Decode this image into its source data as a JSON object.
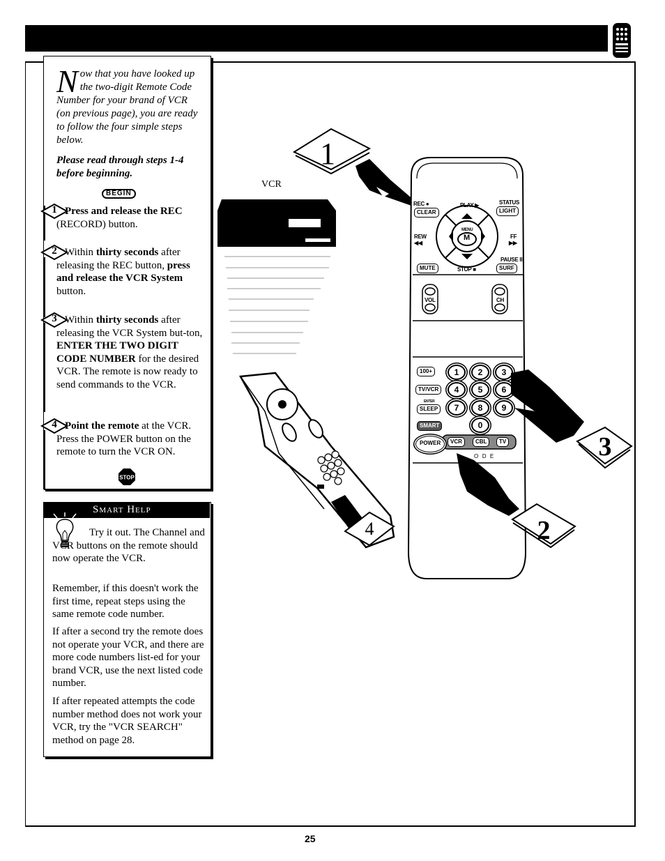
{
  "header": {
    "icon": "remote-control-icon"
  },
  "instructions": {
    "intro_dropcap": "N",
    "intro_text": "ow that you have looked up the two-digit Remote Code Number for your brand of VCR (on previous page), you are ready to follow the four simple steps below.",
    "please_read": "Please read through steps 1-4 before beginning.",
    "begin_label": "BEGIN",
    "steps": [
      {
        "number": "1",
        "parts": [
          {
            "b": true,
            "t": "Press and release the REC"
          },
          {
            "b": false,
            "t": " (RECORD) button."
          }
        ]
      },
      {
        "number": "2",
        "parts": [
          {
            "b": false,
            "t": "Within "
          },
          {
            "b": true,
            "t": "thirty seconds"
          },
          {
            "b": false,
            "t": " after releasing the REC button, "
          },
          {
            "b": true,
            "t": "press and release the VCR System"
          },
          {
            "b": false,
            "t": " button."
          }
        ]
      },
      {
        "number": "3",
        "parts": [
          {
            "b": false,
            "t": "Within "
          },
          {
            "b": true,
            "t": "thirty seconds"
          },
          {
            "b": false,
            "t": " after releasing the VCR System but-ton, "
          },
          {
            "b": true,
            "t": "ENTER THE TWO DIGIT CODE NUMBER"
          },
          {
            "b": false,
            "t": " for the desired VCR. The remote is now ready to send commands to the VCR."
          }
        ]
      },
      {
        "number": "4",
        "parts": [
          {
            "b": true,
            "t": "Point the remote"
          },
          {
            "b": false,
            "t": " at the VCR. Press the POWER button on the remote to turn the VCR ON."
          }
        ]
      }
    ],
    "stop_label": "STOP"
  },
  "smart_help": {
    "title": "Smart Help",
    "paragraphs": [
      "Try it out. The Channel and VCR buttons on the remote should now operate the VCR.",
      "Remember, if this doesn't work the first time, repeat steps using the same remote code number.",
      "If after a second try the remote does not operate your VCR, and there are more code numbers list-ed for your brand VCR, use the next listed code number.",
      "If after repeated attempts the code number method does not work your VCR, try the \"VCR SEARCH\" method on page 28."
    ]
  },
  "illustration": {
    "vcr_label": "VCR",
    "step_markers": [
      "1",
      "2",
      "3",
      "4"
    ],
    "remote": {
      "rec_label": "REC ●",
      "clear_button": "CLEAR",
      "play_label": "PLAY ▶",
      "status_label": "STATUS",
      "light_button": "LIGHT",
      "rew_label": "REW",
      "rew_glyph": "◀◀",
      "menu_label": "MENU",
      "m_button": "M",
      "ff_label": "FF",
      "ff_glyph": "▶▶",
      "pause_label": "PAUSE II",
      "mute_button": "MUTE",
      "stop_label": "STOP ■",
      "surf_button": "SURF",
      "vol_label": "VOL",
      "ch_label": "CH",
      "hundred_button": "100+",
      "tvvcr_button": "TV/VCR",
      "enter_label": "ENTER",
      "sleep_button": "SLEEP",
      "smart_button": "SMART",
      "power_button": "POWER",
      "keypad": [
        "1",
        "2",
        "3",
        "4",
        "5",
        "6",
        "7",
        "8",
        "9",
        "0"
      ],
      "mode_buttons": [
        "VCR",
        "CBL",
        "TV"
      ],
      "code_letters": "O   D   E"
    }
  },
  "footer": {
    "page_number": "25"
  }
}
